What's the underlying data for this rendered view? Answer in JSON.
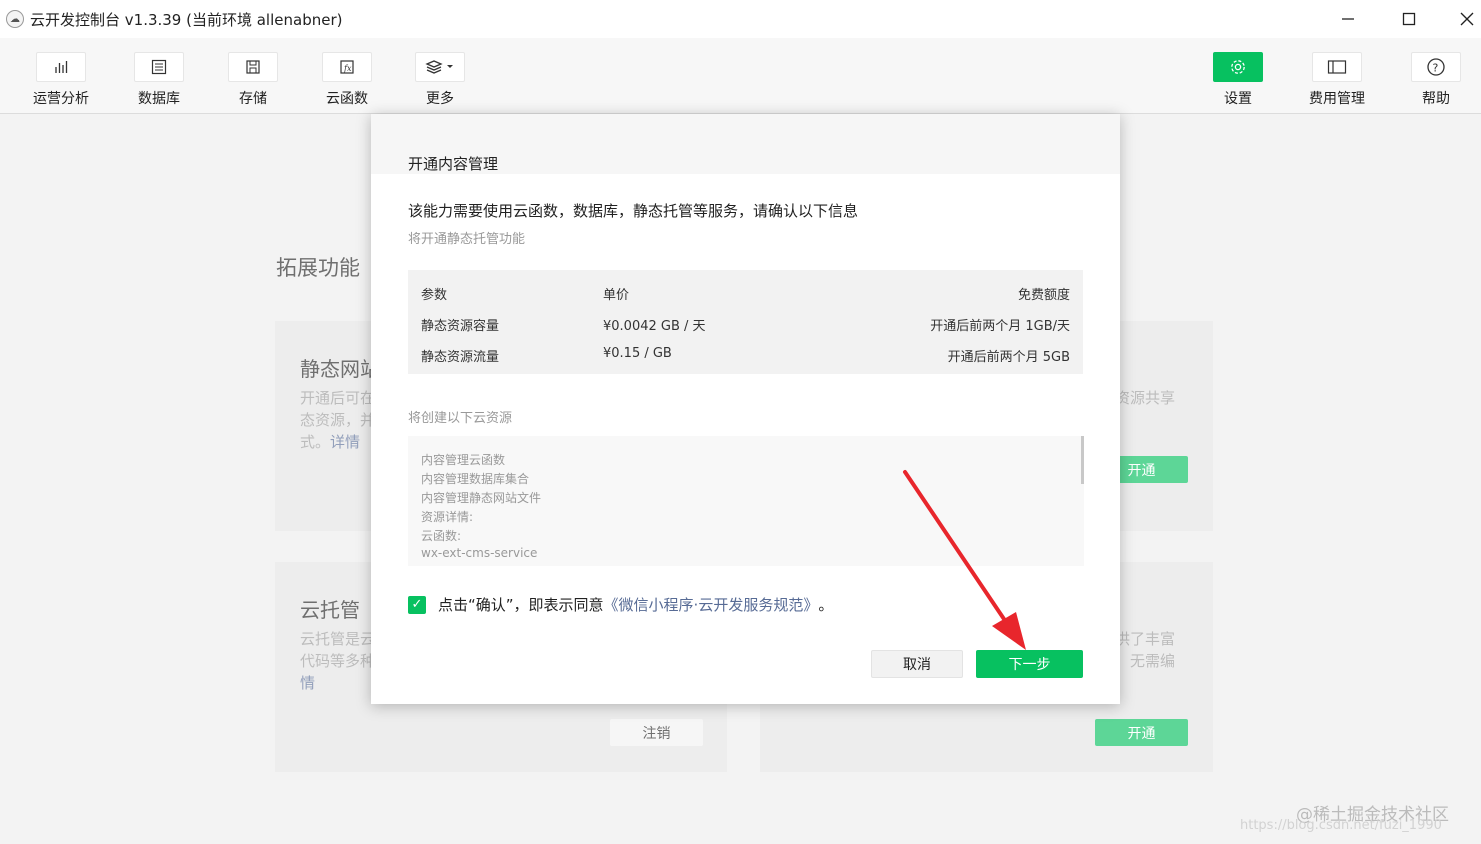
{
  "window": {
    "title": "云开发控制台 v1.3.39  (当前环境 allenabner)",
    "minimize": "—",
    "maximize": "☐",
    "close": "✕"
  },
  "toolbar": {
    "left": [
      {
        "label": "运营分析",
        "icon": "bar-chart-icon"
      },
      {
        "label": "数据库",
        "icon": "database-icon"
      },
      {
        "label": "存储",
        "icon": "storage-icon"
      },
      {
        "label": "云函数",
        "icon": "function-icon"
      },
      {
        "label": "更多",
        "icon": "layers-icon"
      }
    ],
    "right": [
      {
        "label": "设置",
        "icon": "gear-icon"
      },
      {
        "label": "费用管理",
        "icon": "billing-icon"
      },
      {
        "label": "帮助",
        "icon": "help-icon"
      }
    ]
  },
  "page": {
    "section_title": "拓展功能",
    "card_static": {
      "title": "静态网站",
      "desc_lines": [
        "开通后可在",
        "态资源，并",
        "式。"
      ],
      "link": "详情"
    },
    "card_static_right": {
      "desc": "资源共享",
      "button": "开通"
    },
    "card_hosting": {
      "title": "云托管",
      "desc_lines": [
        "云托管是云",
        "代码等多种"
      ],
      "link": "情",
      "button": "注销"
    },
    "card_hosting_right": {
      "desc_lines": [
        "供了丰富",
        "无需编"
      ],
      "button": "开通"
    }
  },
  "modal": {
    "title": "开通内容管理",
    "intro": "该能力需要使用云函数，数据库，静态托管等服务，请确认以下信息",
    "sub": "将开通静态托管功能",
    "pricing": {
      "headers": [
        "参数",
        "单价",
        "免费额度"
      ],
      "rows": [
        [
          "静态资源容量",
          "¥0.0042 GB / 天",
          "开通后前两个月 1GB/天"
        ],
        [
          "静态资源流量",
          "¥0.15 / GB",
          "开通后前两个月 5GB"
        ]
      ]
    },
    "resources_label": "将创建以下云资源",
    "resources": [
      "内容管理云函数",
      "内容管理数据库集合",
      "内容管理静态网站文件",
      "资源详情:",
      "云函数:",
      "wx-ext-cms-service"
    ],
    "agree_prefix": "点击“确认”，即表示同意",
    "agree_link": "《微信小程序·云开发服务规范》",
    "agree_suffix": "。",
    "cancel": "取消",
    "next": "下一步"
  },
  "watermark": {
    "line1": "@稀土掘金技术社区",
    "line2": "https://blog.csdn.net/fuzi_1990"
  },
  "colors": {
    "accent": "#07c160",
    "link": "#576b95",
    "annotation_arrow": "#e8262c"
  }
}
